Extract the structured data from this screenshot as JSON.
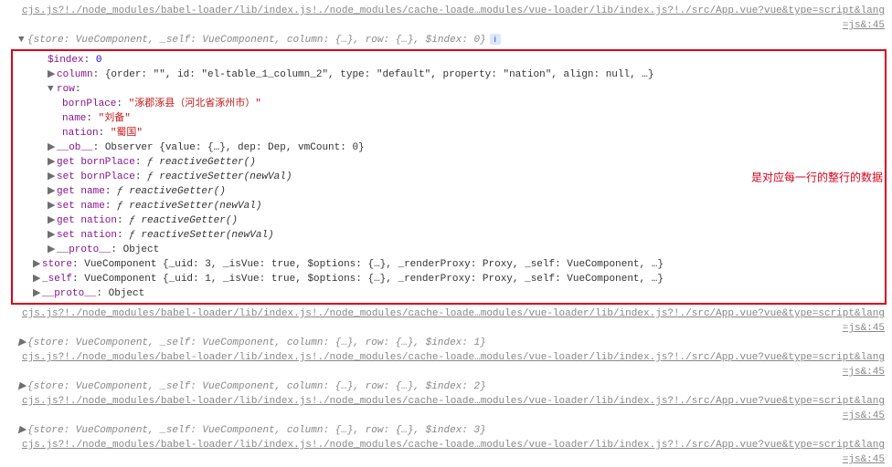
{
  "src": {
    "short": "cjs.js?!./node_modules/babel-loader/lib/index.js!./node_modules/cache-loade…modules/vue-loader/lib/index.js?!./src/App.vue?vue&type=script&lang",
    "tail": "=js&:45"
  },
  "entries": {
    "summary0": "{store: VueComponent, _self: VueComponent, column: {…}, row: {…}, $index: 0}",
    "summary1": "{store: VueComponent, _self: VueComponent, column: {…}, row: {…}, $index: 1}",
    "summary2": "{store: VueComponent, _self: VueComponent, column: {…}, row: {…}, $index: 2}",
    "summary3": "{store: VueComponent, _self: VueComponent, column: {…}, row: {…}, $index: 3}"
  },
  "expanded": {
    "index": {
      "label": "$index",
      "value": "0"
    },
    "columnLabel": "column",
    "columnVal": "{order: \"\", id: \"el-table_1_column_2\", type: \"default\", property: \"nation\", align: null, …}",
    "rowLabel": "row",
    "row": {
      "bornPlace": {
        "label": "bornPlace",
        "value": "\"涿郡涿县（河北省涿州市）\""
      },
      "name": {
        "label": "name",
        "value": "\"刘备\""
      },
      "nation": {
        "label": "nation",
        "value": "\"蜀国\""
      }
    },
    "ob": {
      "label": "__ob__",
      "value": "Observer {value: {…}, dep: Dep, vmCount: 0}"
    },
    "getBornPlace": {
      "label": "get bornPlace",
      "value": "ƒ reactiveGetter()"
    },
    "setBornPlace": {
      "label": "set bornPlace",
      "value": "ƒ reactiveSetter(newVal)"
    },
    "getName": {
      "label": "get name",
      "value": "ƒ reactiveGetter()"
    },
    "setName": {
      "label": "set name",
      "value": "ƒ reactiveSetter(newVal)"
    },
    "getNation": {
      "label": "get nation",
      "value": "ƒ reactiveGetter()"
    },
    "setNation": {
      "label": "set nation",
      "value": "ƒ reactiveSetter(newVal)"
    },
    "proto": {
      "label": "__proto__",
      "value": "Object"
    },
    "store": {
      "label": "store",
      "value": "VueComponent {_uid: 3, _isVue: true, $options: {…}, _renderProxy: Proxy, _self: VueComponent, …}"
    },
    "self": {
      "label": "_self",
      "value": "VueComponent {_uid: 1, _isVue: true, $options: {…}, _renderProxy: Proxy, _self: VueComponent, …}"
    },
    "proto2": {
      "label": "__proto__",
      "value": "Object"
    }
  },
  "annotation": "是对应每一行的整行的数据",
  "glyph": {
    "right": "▶",
    "down": "▼",
    "info": "i"
  }
}
